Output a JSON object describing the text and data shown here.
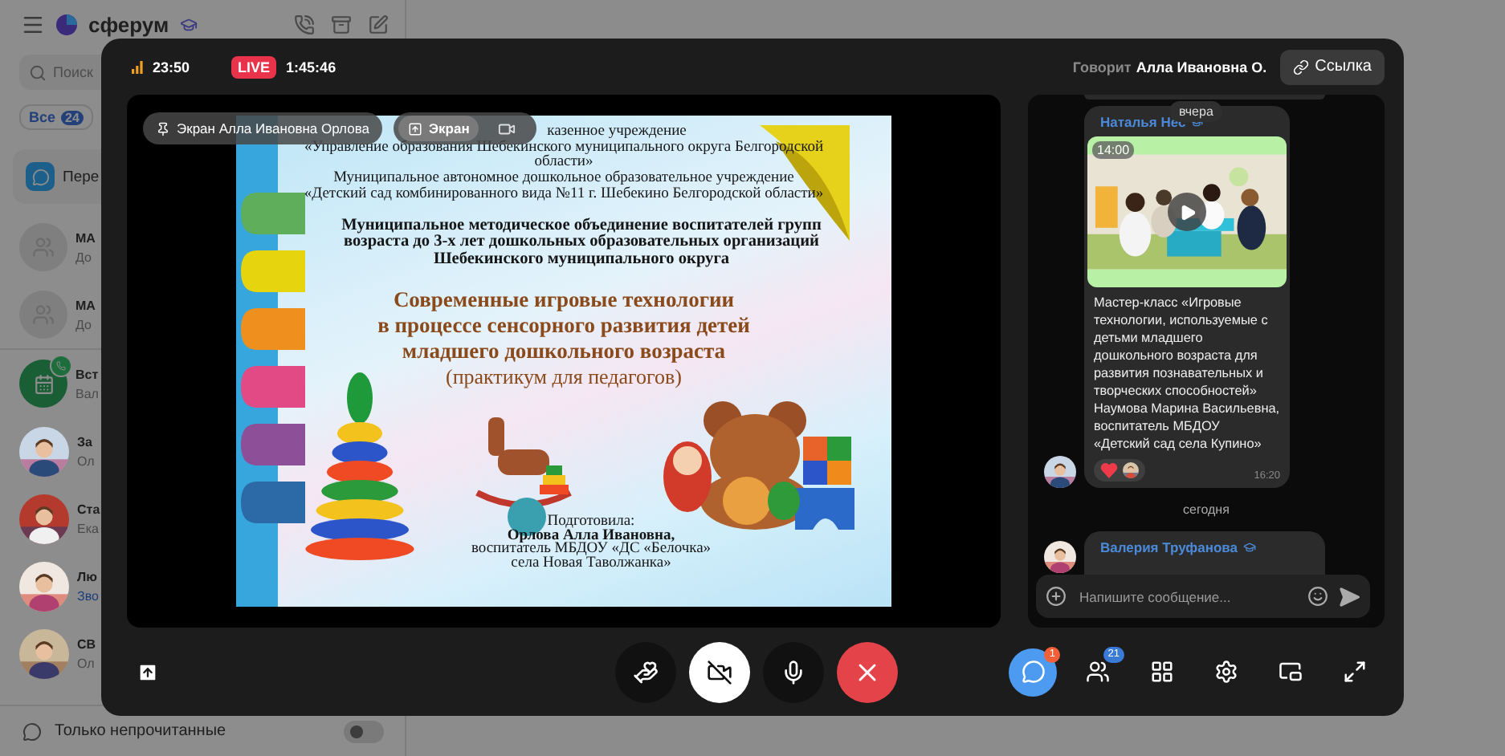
{
  "sidebar": {
    "brand": "сферум",
    "search": {
      "placeholder": "Поиск"
    },
    "filter": {
      "label": "Все",
      "count": "24"
    },
    "pinned": {
      "title": "Пере"
    },
    "chats": [
      {
        "kind": "group",
        "name": "МА",
        "preview": "До",
        "highlight": false
      },
      {
        "kind": "group",
        "name": "МА",
        "preview": "До",
        "highlight": false
      },
      {
        "kind": "call",
        "name": "Вст",
        "preview": "Вал",
        "highlight": false
      },
      {
        "name": "За",
        "preview": "Ол",
        "highlight": false
      },
      {
        "name": "Ста",
        "preview": "Ека",
        "highlight": false
      },
      {
        "name": "Лю",
        "preview": "Зво",
        "highlight": true
      },
      {
        "name": "СВ",
        "preview": "Ол",
        "highlight": false
      }
    ],
    "unread_filter": {
      "label": "Только непрочитанные",
      "on": false
    }
  },
  "call": {
    "time": "23:50",
    "live": "LIVE",
    "duration": "1:45:46",
    "speaking": {
      "label": "Говорит",
      "name": "Алла Ивановна О."
    },
    "link_button": "Ссылка",
    "pinned_chip": "Экран Алла Ивановна Орлова",
    "sources": [
      {
        "kind": "screen",
        "label": "Экран",
        "selected": true
      },
      {
        "kind": "camera",
        "selected": false
      }
    ],
    "slide": {
      "header": [
        "казенное учреждение",
        "«Управление образования Шебекинского муниципального округа Белгородской",
        "области»",
        "Муниципальное автономное дошкольное образовательное учреждение",
        "«Детский сад комбинированного вида №11 г. Шебекино Белгородской области»"
      ],
      "organization": [
        "Муниципальное методическое объединение воспитателей групп",
        "возраста до 3-х лет дошкольных образовательных организаций",
        "Шебекинского муниципального округа"
      ],
      "title": [
        "Современные игровые технологии",
        "в процессе сенсорного развития детей",
        "младшего дошкольного возраста"
      ],
      "subtitle": "(практикум для педагогов)",
      "author_caption": "Подготовила:",
      "author": "Орлова Алла Ивановна,",
      "author_details": [
        "воспитатель МБДОУ  «ДС «Белочка»",
        "села Новая Таволжанка»"
      ]
    },
    "controls": [
      {
        "kind": "hand"
      },
      {
        "kind": "camera",
        "on": false
      },
      {
        "kind": "mic",
        "on": true
      },
      {
        "kind": "leave"
      }
    ],
    "panel_buttons": [
      {
        "kind": "chat",
        "badge": "1",
        "selected": true
      },
      {
        "kind": "participants",
        "badge": "21",
        "selected": false
      },
      {
        "kind": "grid",
        "selected": false
      },
      {
        "kind": "settings",
        "selected": false
      },
      {
        "kind": "pip",
        "selected": false
      },
      {
        "kind": "fullscreen",
        "selected": false
      }
    ]
  },
  "chat": {
    "floating_date": "вчера",
    "items": [
      {
        "kind": "message",
        "author": "Наталья Нес",
        "attachment": {
          "kind": "video",
          "duration": "14:00"
        },
        "text": "Мастер-класс «Игровые технологии, используемые с детьми младшего дошкольного возраста для развития познавательных и творческих способностей»\nНаумова Марина Васильевна, воспитатель МБДОУ\n«Детский сад села Купино»",
        "reactions": [
          {
            "kind": "heart"
          }
        ],
        "time": "16:20"
      },
      {
        "kind": "date",
        "label": "сегодня"
      },
      {
        "kind": "message",
        "author": "Валерия Труфанова"
      }
    ],
    "input": {
      "placeholder": "Напишите сообщение..."
    }
  }
}
